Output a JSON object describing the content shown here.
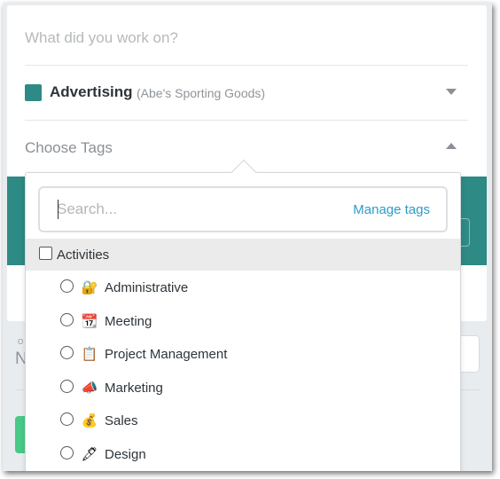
{
  "entry": {
    "work_placeholder": "What did you work on?",
    "project": {
      "name": "Advertising",
      "client": "(Abe's Sporting Goods)",
      "color": "#2e8a84"
    },
    "tags_placeholder": "Choose Tags"
  },
  "background": {
    "small_label": "O",
    "big_letter": "N"
  },
  "dropdown": {
    "search_placeholder": "Search...",
    "manage_tags_label": "Manage tags",
    "group": {
      "label": "Activities",
      "tags": [
        {
          "label": "Administrative",
          "icon": "lock-key-icon",
          "glyph": "🔐"
        },
        {
          "label": "Meeting",
          "icon": "calendar-icon",
          "glyph": "📆"
        },
        {
          "label": "Project Management",
          "icon": "clipboard-icon",
          "glyph": "📋"
        },
        {
          "label": "Marketing",
          "icon": "megaphone-icon",
          "glyph": "📣"
        },
        {
          "label": "Sales",
          "icon": "money-bag-icon",
          "glyph": "💰"
        },
        {
          "label": "Design",
          "icon": "pen-icon",
          "glyph": "🖋"
        }
      ]
    }
  },
  "colors": {
    "accent": "#2e8a84",
    "link": "#2b9dc9",
    "success": "#48c987"
  }
}
